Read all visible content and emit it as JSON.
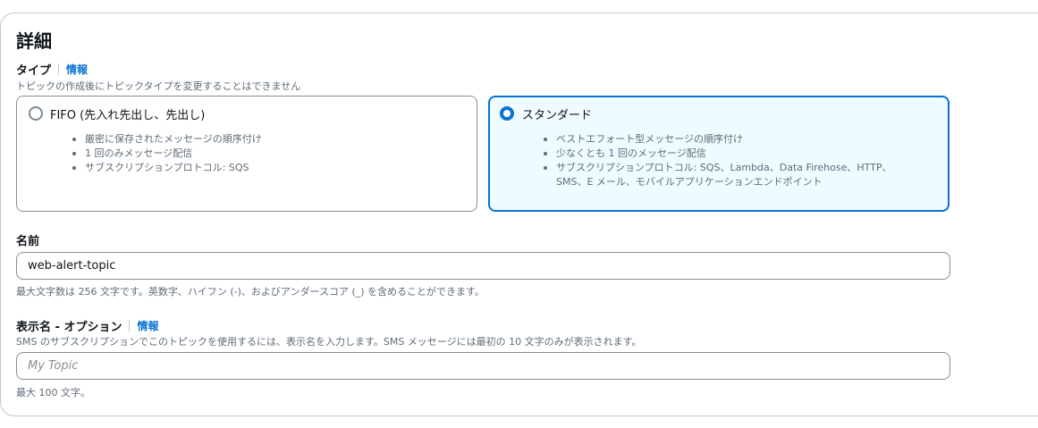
{
  "section": {
    "title": "詳細"
  },
  "type_field": {
    "label": "タイプ",
    "info": "情報",
    "description": "トピックの作成後にトピックタイプを変更することはできません",
    "options": [
      {
        "label": "FIFO (先入れ先出し、先出し)",
        "selected": false,
        "bullets": [
          "厳密に保存されたメッセージの順序付け",
          "1 回のみメッセージ配信",
          "サブスクリプションプロトコル: SQS"
        ]
      },
      {
        "label": "スタンダード",
        "selected": true,
        "bullets": [
          "ベストエフォート型メッセージの順序付け",
          "少なくとも 1 回のメッセージ配信",
          "サブスクリプションプロトコル: SQS、Lambda、Data Firehose、HTTP、SMS、E メール、モバイルアプリケーションエンドポイント"
        ]
      }
    ]
  },
  "name_field": {
    "label": "名前",
    "value": "web-alert-topic",
    "hint": "最大文字数は 256 文字です。英数字、ハイフン (-)、およびアンダースコア (_) を含めることができます。"
  },
  "display_name_field": {
    "label": "表示名 - オプション",
    "info": "情報",
    "description": "SMS のサブスクリプションでこのトピックを使用するには、表示名を入力します。SMS メッセージには最初の 10 文字のみが表示されます。",
    "value": "",
    "placeholder": "My Topic",
    "hint": "最大 100 文字。"
  },
  "colors": {
    "accent": "#0972d3",
    "selected_tile_bg": "#f0fbff",
    "border": "#8c8c94",
    "secondary_text": "#5f6b7a"
  }
}
